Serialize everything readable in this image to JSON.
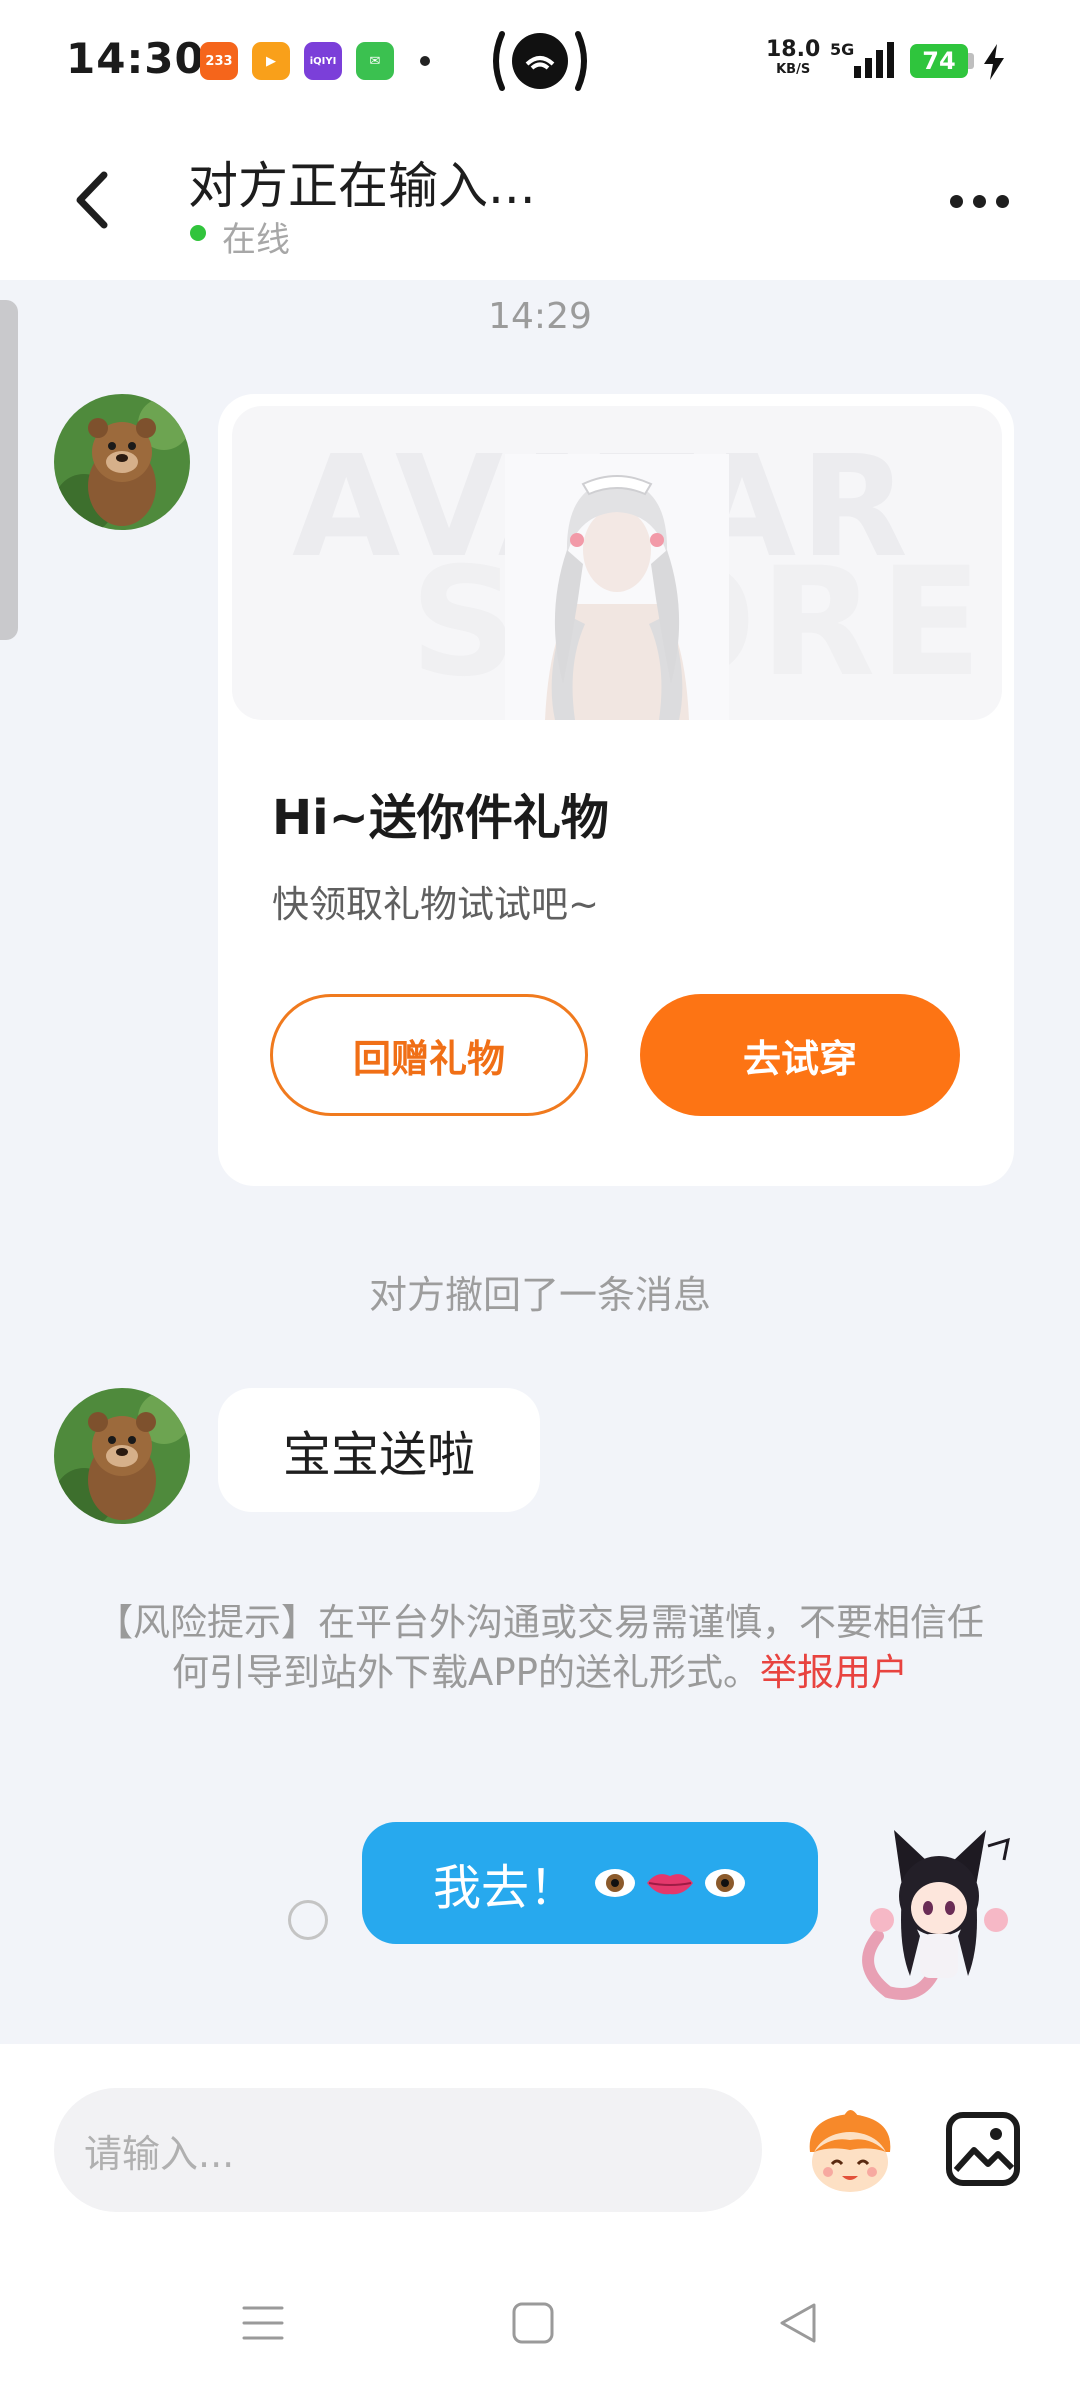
{
  "status_bar": {
    "time": "14:30",
    "apps": [
      {
        "name": "233",
        "color": "#f5651b"
      },
      {
        "name": "▶",
        "color": "#f9a01a"
      },
      {
        "name": "iQIYI",
        "color": "#7b3fd9"
      },
      {
        "name": "✉",
        "color": "#3bc150"
      }
    ],
    "net_speed": "18.0",
    "net_unit": "KB/S",
    "network": "5G",
    "battery": "74"
  },
  "header": {
    "title": "对方正在输入...",
    "status": "在线"
  },
  "chat": {
    "timestamp": "14:29",
    "gift_card": {
      "title": "Hi~送你件礼物",
      "subtitle": "快领取礼物试试吧~",
      "watermark_1": "AVATAR",
      "watermark_2": "STORE",
      "return_button": "回赠礼物",
      "try_button": "去试穿"
    },
    "recall_notice": "对方撤回了一条消息",
    "incoming_message": "宝宝送啦",
    "risk_notice": "【风险提示】在平台外沟通或交易需谨慎，不要相信任何引导到站外下载APP的送礼形式。",
    "report_link": "举报用户",
    "outgoing_message": "我去！"
  },
  "input_bar": {
    "placeholder": "请输入..."
  },
  "colors": {
    "accent_orange": "#fd7414",
    "bubble_blue": "#27a9ee",
    "online_green": "#31c43c",
    "report_red": "#e8433f"
  },
  "icons": [
    "back-arrow-icon",
    "more-icon",
    "emoji-mascot-icon",
    "image-icon",
    "menu-nav-icon",
    "home-nav-icon",
    "back-nav-icon"
  ]
}
